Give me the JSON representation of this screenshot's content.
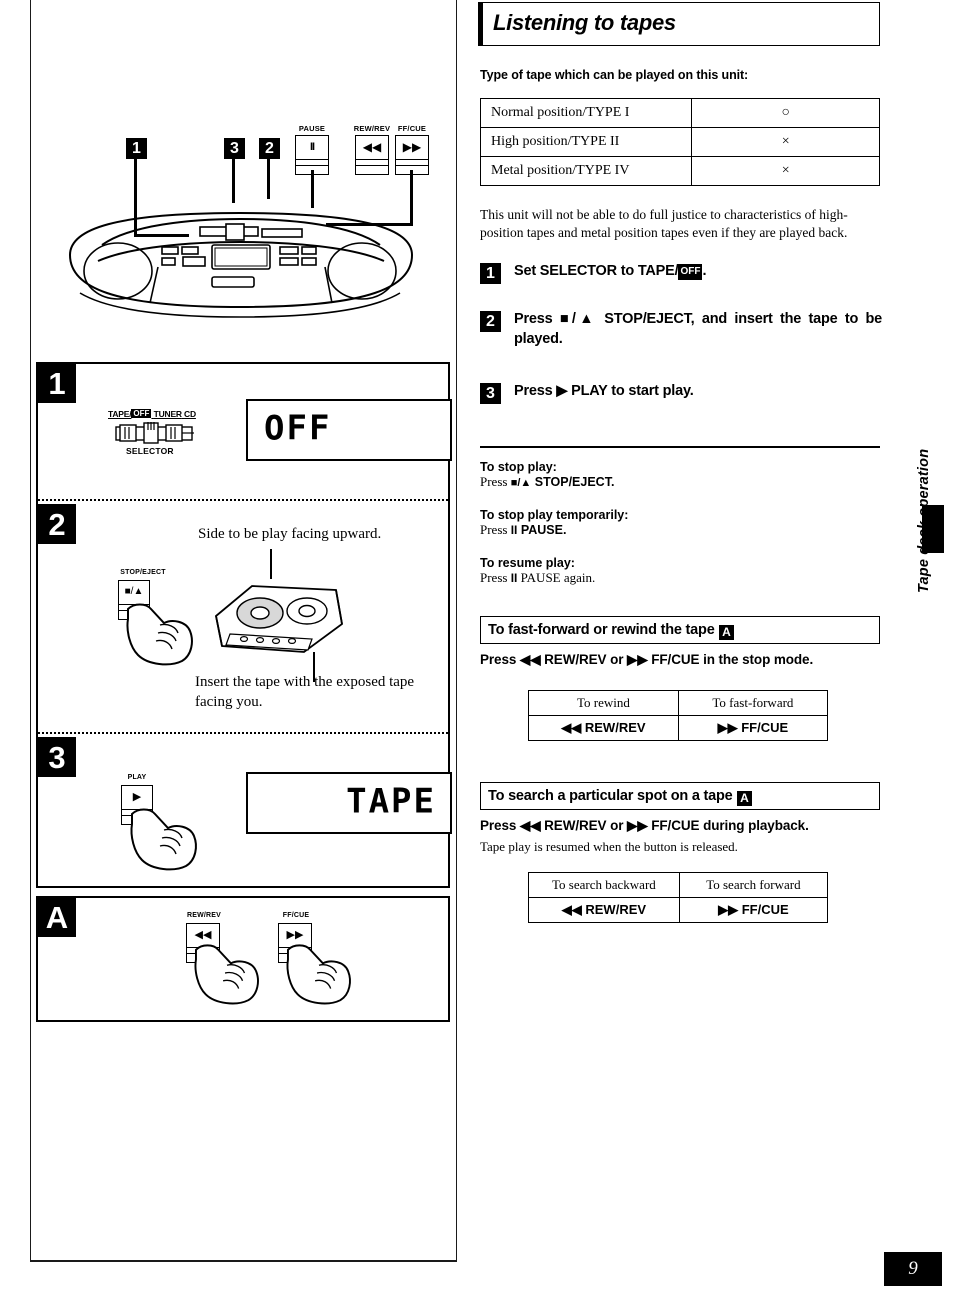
{
  "page": {
    "number": "9",
    "side_tab": "Tape deck operation"
  },
  "header": {
    "title": "Listening to tapes"
  },
  "tape_types": {
    "lead": "Type of tape which can be played on this unit:",
    "rows": [
      {
        "label": "Normal position/TYPE I",
        "mark": "○"
      },
      {
        "label": "High position/TYPE II",
        "mark": "×"
      },
      {
        "label": "Metal position/TYPE IV",
        "mark": "×"
      }
    ],
    "note": "This unit will not be able to do full justice to characteristics of high-position tapes and metal position tapes even if they are played back."
  },
  "steps": [
    {
      "num": "1",
      "text_before": "Set SELECTOR to TAPE/",
      "tag": "OFF",
      "text_after": "."
    },
    {
      "num": "2",
      "text_before": "Press ■/▲ STOP/EJECT, and insert the tape to be played.",
      "tag": "",
      "text_after": ""
    },
    {
      "num": "3",
      "text_before": "Press ▶ PLAY to start play.",
      "tag": "",
      "text_after": ""
    }
  ],
  "tips": [
    {
      "head": "To stop play:",
      "body_prefix": "Press ",
      "body_sym": "■/▲",
      "body_suffix": " STOP/EJECT."
    },
    {
      "head": "To stop play temporarily:",
      "body_prefix": "Press ",
      "body_sym": "II",
      "body_suffix": " PAUSE."
    },
    {
      "head": "To resume play:",
      "body_prefix": "Press ",
      "body_sym": "II",
      "body_suffix": " PAUSE again."
    }
  ],
  "ff_section": {
    "title": "To fast-forward or rewind the tape",
    "badge": "A",
    "instruction": "Press ◀◀ REW/REV or ▶▶ FF/CUE in the stop mode.",
    "table": {
      "headers": [
        "To rewind",
        "To fast-forward"
      ],
      "values": [
        "◀◀ REW/REV",
        "▶▶ FF/CUE"
      ]
    }
  },
  "search_section": {
    "title": "To search a particular spot on a tape",
    "badge": "A",
    "instruction": "Press ◀◀ REW/REV or ▶▶ FF/CUE during playback.",
    "note": "Tape play is resumed when the button is released.",
    "table": {
      "headers": [
        "To search backward",
        "To search forward"
      ],
      "values": [
        "◀◀ REW/REV",
        "▶▶ FF/CUE"
      ]
    }
  },
  "illustration": {
    "callouts": [
      {
        "id": "1",
        "label": ""
      },
      {
        "id": "3",
        "label": ""
      },
      {
        "id": "2",
        "label": ""
      }
    ],
    "buttons": [
      {
        "name": "PAUSE",
        "glyph": "II"
      },
      {
        "name": "REW/REV",
        "glyph": "◀◀"
      },
      {
        "name": "FF/CUE",
        "glyph": "▶▶"
      }
    ]
  },
  "panels": {
    "step1": {
      "badge": "1",
      "selector_labels": {
        "tape": "TAPE/",
        "off": "OFF",
        "tuner": "TUNER",
        "cd": "CD"
      },
      "selector_caption": "SELECTOR",
      "display": "OFF"
    },
    "step2": {
      "badge": "2",
      "button_label": "STOP/EJECT",
      "button_glyph": "■/▲",
      "caption_top": "Side to be play facing upward.",
      "caption_bottom": "Insert the tape with the exposed tape facing you."
    },
    "step3": {
      "badge": "3",
      "button_label": "PLAY",
      "button_glyph": "▶",
      "display": "TAPE"
    },
    "panelA": {
      "badge": "A",
      "buttons": [
        {
          "label": "REW/REV",
          "glyph": "◀◀"
        },
        {
          "label": "FF/CUE",
          "glyph": "▶▶"
        }
      ]
    }
  }
}
